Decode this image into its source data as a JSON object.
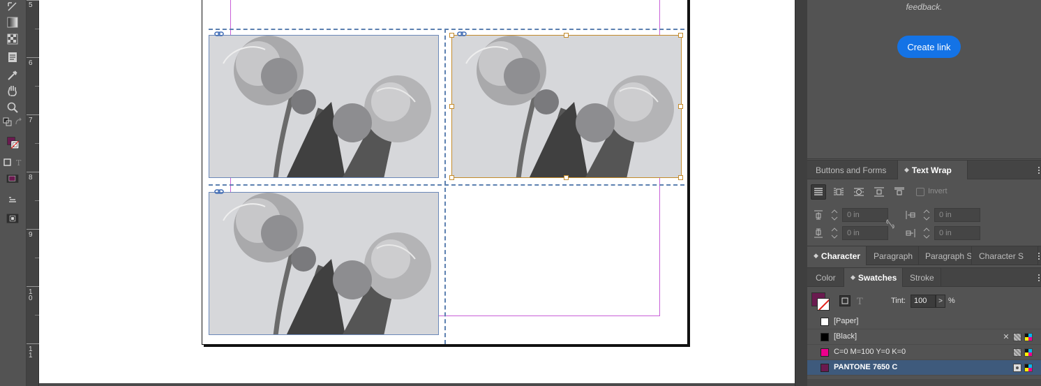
{
  "ruler": {
    "labels": [
      "5",
      "6",
      "7",
      "8",
      "9",
      "1\n0",
      "1\n1"
    ]
  },
  "panels": {
    "feedback_text": "feedback.",
    "create_link_label": "Create link",
    "tabs_row1": [
      "Buttons and Forms",
      "Text Wrap"
    ],
    "tabs_row2": [
      "Character",
      "Paragraph",
      "Paragraph S",
      "Character S"
    ],
    "tabs_row3": [
      "Color",
      "Swatches",
      "Stroke"
    ]
  },
  "text_wrap": {
    "invert_label": "Invert",
    "top_offset": "0 in",
    "bottom_offset": "0 in",
    "left_offset": "0 in",
    "right_offset": "0 in"
  },
  "swatches": {
    "tint_label": "Tint:",
    "tint_value": "100",
    "tint_unit": "%",
    "items": [
      {
        "name": "[Paper]",
        "color": "#ffffff"
      },
      {
        "name": "[Black]",
        "color": "#000000"
      },
      {
        "name": "C=0 M=100 Y=0 K=0",
        "color": "#ec008c"
      },
      {
        "name": "PANTONE 7650 C",
        "color": "#6a1a4f"
      }
    ]
  },
  "colors": {
    "fill": "#6a1a4f",
    "accent_blue": "#1473e6",
    "selection": "#c38a2a",
    "frame_edge": "#6b88b8",
    "margin_guide": "#c85fd8"
  }
}
